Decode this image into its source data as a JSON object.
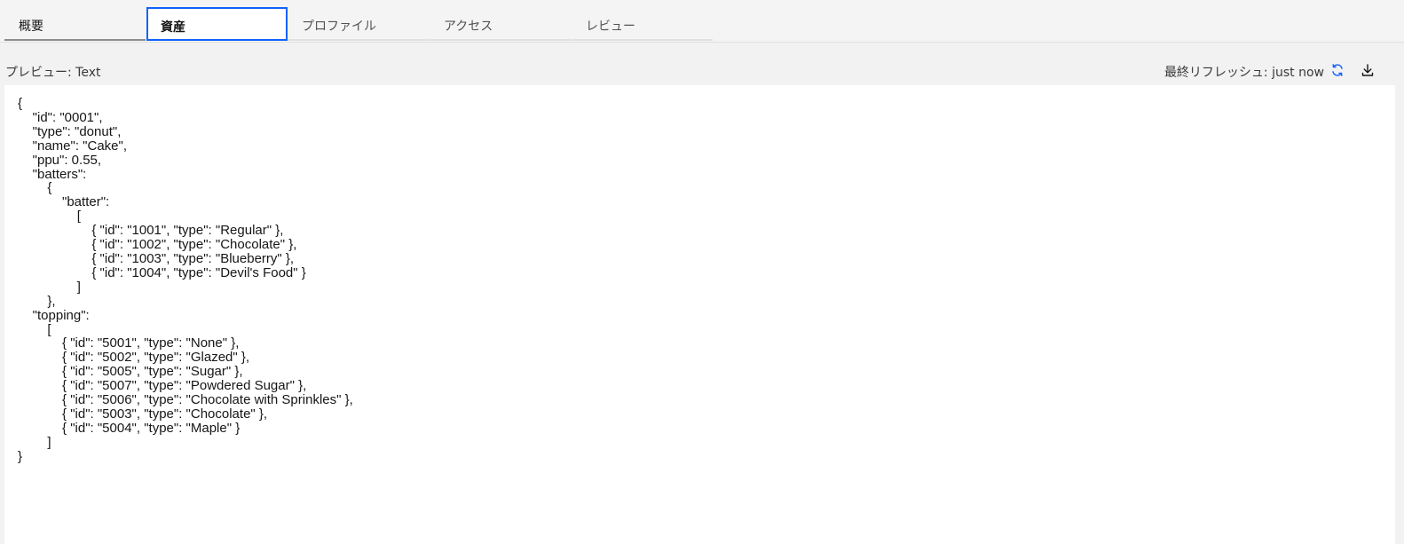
{
  "tabs": [
    {
      "label": "概要"
    },
    {
      "label": "資産"
    },
    {
      "label": "プロファイル"
    },
    {
      "label": "アクセス"
    },
    {
      "label": "レビュー"
    }
  ],
  "toolbar": {
    "preview_label": "プレビュー: Text",
    "last_refresh": "最終リフレッシュ: just now",
    "refresh_icon": "refresh-icon",
    "download_icon": "download-icon",
    "accent_color": "#0f62fe"
  },
  "preview": {
    "content": "{\n\t\"id\": \"0001\",\n\t\"type\": \"donut\",\n\t\"name\": \"Cake\",\n\t\"ppu\": 0.55,\n\t\"batters\":\n\t\t{\n\t\t\t\"batter\":\n\t\t\t\t[\n\t\t\t\t\t{ \"id\": \"1001\", \"type\": \"Regular\" },\n\t\t\t\t\t{ \"id\": \"1002\", \"type\": \"Chocolate\" },\n\t\t\t\t\t{ \"id\": \"1003\", \"type\": \"Blueberry\" },\n\t\t\t\t\t{ \"id\": \"1004\", \"type\": \"Devil's Food\" }\n\t\t\t\t]\n\t\t},\n\t\"topping\":\n\t\t[\n\t\t\t{ \"id\": \"5001\", \"type\": \"None\" },\n\t\t\t{ \"id\": \"5002\", \"type\": \"Glazed\" },\n\t\t\t{ \"id\": \"5005\", \"type\": \"Sugar\" },\n\t\t\t{ \"id\": \"5007\", \"type\": \"Powdered Sugar\" },\n\t\t\t{ \"id\": \"5006\", \"type\": \"Chocolate with Sprinkles\" },\n\t\t\t{ \"id\": \"5003\", \"type\": \"Chocolate\" },\n\t\t\t{ \"id\": \"5004\", \"type\": \"Maple\" }\n\t\t]\n}"
  }
}
